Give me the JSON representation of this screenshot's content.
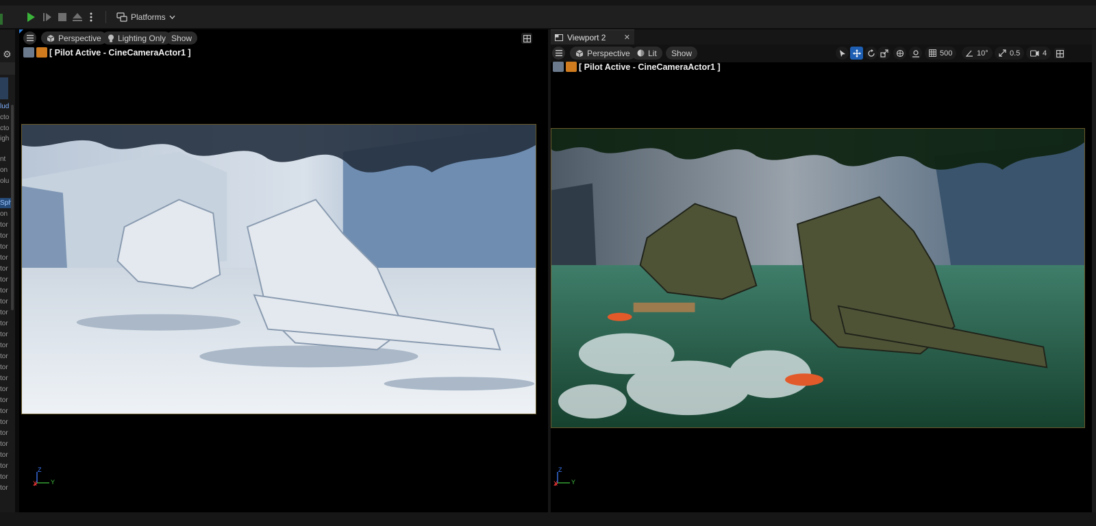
{
  "toolbar": {
    "platforms_label": "Platforms"
  },
  "outliner_fragments": [
    "lud",
    "cto",
    "cto",
    "igh",
    "nt",
    "on",
    "olu",
    "Sph",
    "on",
    "tor",
    "tor",
    "tor",
    "tor",
    "tor",
    "tor",
    "tor",
    "tor",
    "tor",
    "tor",
    "tor",
    "tor",
    "tor",
    "tor",
    "tor",
    "tor",
    "tor",
    "tor",
    "tor",
    "tor",
    "tor",
    "tor",
    "tor",
    "tor",
    "tor"
  ],
  "viewport1": {
    "view_mode": "Perspective",
    "lighting_mode": "Lighting Only",
    "show_label": "Show",
    "pilot_label": "[ Pilot Active - CineCameraActor1 ]",
    "axis_z": "Z",
    "axis_x": "X",
    "axis_y": "Y"
  },
  "viewport2": {
    "tab_title": "Viewport 2",
    "view_mode": "Perspective",
    "lighting_mode": "Lit",
    "show_label": "Show",
    "pilot_label": "[ Pilot Active - CineCameraActor1 ]",
    "grid_snap": "500",
    "rotation_snap": "10°",
    "scale_snap": "0.5",
    "camera_speed": "4",
    "axis_z": "Z",
    "axis_x": "X",
    "axis_y": "Y"
  },
  "colors": {
    "play_green": "#3bb33b",
    "accent_blue": "#1e5fb3",
    "camera_orange": "#d07c1e"
  }
}
